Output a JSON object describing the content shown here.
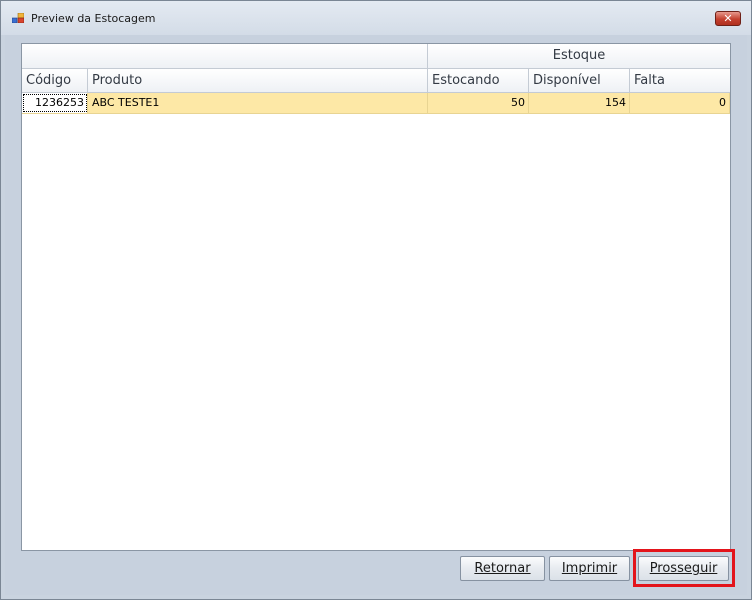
{
  "window": {
    "title": "Preview da Estocagem",
    "close_symbol": "✕"
  },
  "grid": {
    "band": {
      "group_label": "Estoque"
    },
    "columns": [
      "Código",
      "Produto",
      "Estocando",
      "Disponível",
      "Falta"
    ],
    "rows": [
      {
        "codigo": "1236253",
        "produto": "ABC TESTE1",
        "estocando": "50",
        "disponivel": "154",
        "falta": "0"
      }
    ]
  },
  "buttons": {
    "retornar": "Retornar",
    "imprimir": "Imprimir",
    "prosseguir": "Prosseguir"
  },
  "colors": {
    "row_highlight": "#fde8a6",
    "annotation_box": "#e3141b"
  },
  "icons": {
    "app": "window-app-icon",
    "close": "close-icon"
  }
}
